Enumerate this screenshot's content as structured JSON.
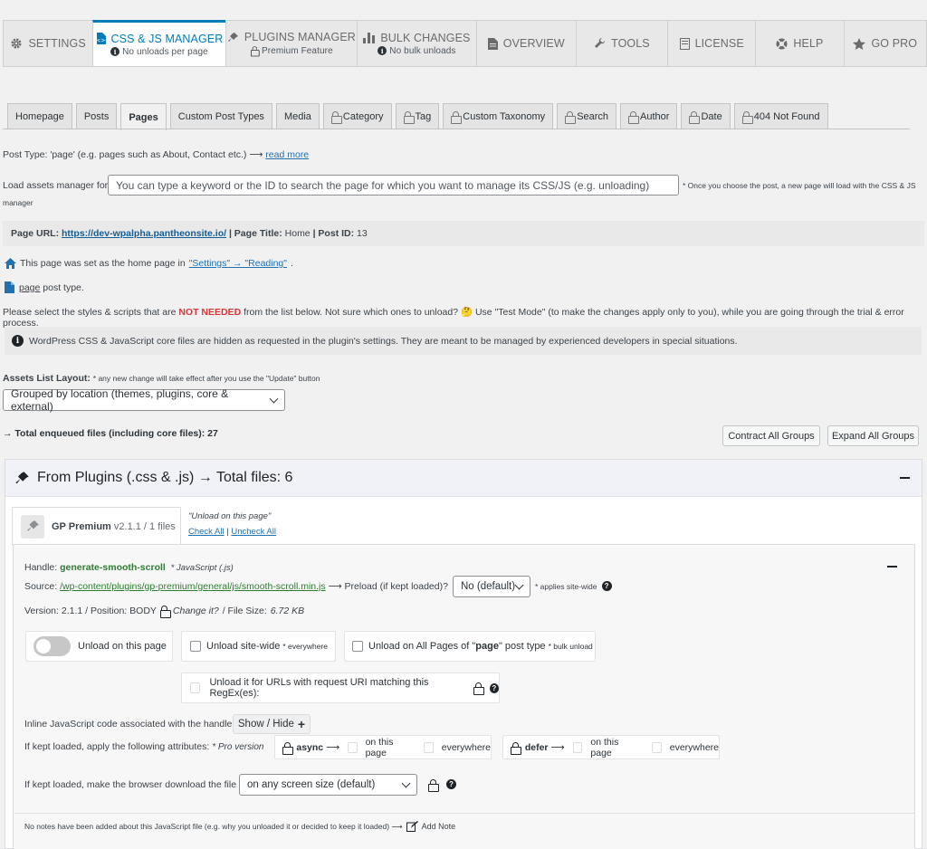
{
  "colors": {
    "accent": "#007cba",
    "red": "#d63638",
    "green": "#2e7d32",
    "link": "#2271b1"
  },
  "topnav": [
    {
      "label": "SETTINGS",
      "icon": "gear-icon",
      "sub": ""
    },
    {
      "label": "CSS & JS MANAGER",
      "icon": "css-js-icon",
      "sub": "No unloads per page",
      "active": true
    },
    {
      "label": "PLUGINS MANAGER",
      "icon": "plug-icon",
      "sub": "Premium Feature"
    },
    {
      "label": "BULK CHANGES",
      "icon": "bars-icon",
      "sub": "No bulk unloads"
    },
    {
      "label": "OVERVIEW",
      "icon": "document-icon",
      "sub": ""
    },
    {
      "label": "TOOLS",
      "icon": "wrench-icon",
      "sub": ""
    },
    {
      "label": "LICENSE",
      "icon": "license-icon",
      "sub": ""
    },
    {
      "label": "HELP",
      "icon": "lifebuoy-icon",
      "sub": ""
    },
    {
      "label": "GO PRO",
      "icon": "star-icon",
      "sub": ""
    }
  ],
  "subtabs": [
    {
      "label": "Homepage",
      "locked": false
    },
    {
      "label": "Posts",
      "locked": false
    },
    {
      "label": "Pages",
      "locked": false,
      "active": true
    },
    {
      "label": "Custom Post Types",
      "locked": false
    },
    {
      "label": "Media",
      "locked": false
    },
    {
      "label": "Category",
      "locked": true
    },
    {
      "label": "Tag",
      "locked": true
    },
    {
      "label": "Custom Taxonomy",
      "locked": true
    },
    {
      "label": "Search",
      "locked": true
    },
    {
      "label": "Author",
      "locked": true
    },
    {
      "label": "Date",
      "locked": true
    },
    {
      "label": "404 Not Found",
      "locked": true
    }
  ],
  "post_type_line": {
    "text": "Post Type: 'page' (e.g. pages such as About, Contact etc.) ⟶ ",
    "link": "read more"
  },
  "load_for": {
    "label": "Load assets manager for:",
    "placeholder": "You can type a keyword or the ID to search the page for which you want to manage its CSS/JS (e.g. unloading)",
    "note_1": "* Once you choose the post, a new page will load with the CSS & JS",
    "note_2": "manager"
  },
  "page_info": {
    "url_label": "Page URL:",
    "url": "https://dev-wpalpha.pantheonsite.io/",
    "title_label": "| Page Title:",
    "title": "Home",
    "id_label": "| Post ID:",
    "id": "13"
  },
  "home_notice": {
    "text": "This page was set as the home page in ",
    "link": "\"Settings\" → \"Reading\"",
    "end": "."
  },
  "post_type_notice": {
    "link": "page",
    "text": " post type."
  },
  "select_notice": {
    "before": "Please select the styles & scripts that are ",
    "highlight": "NOT NEEDED",
    "after": " from the list below. Not sure which ones to unload? 🤔 Use \"Test Mode\" (to make the changes apply only to you), while you are going through the trial & error process."
  },
  "core_notice": "WordPress CSS & JavaScript core files are hidden as requested in the plugin's settings. They are meant to be managed by experienced developers in special situations.",
  "layout": {
    "label": "Assets List Layout:",
    "note": "* any new change will take effect after you use the \"Update\" button",
    "value": "Grouped by location (themes, plugins, core & external)"
  },
  "total_enqueued": "→ Total enqueued files (including core files): 27",
  "buttons": {
    "contract": "Contract All Groups",
    "expand": "Expand All Groups"
  },
  "group": {
    "title": "From Plugins (.css & .js) → Total files: 6",
    "plugin_name": "GP Premium",
    "plugin_version": "v2.1.1 / 1 files",
    "unload_on_page": "\"Unload on this page\"",
    "check_all": "Check All",
    "uncheck_all": "Uncheck All"
  },
  "asset": {
    "handle_label": "Handle:",
    "handle": "generate-smooth-scroll",
    "handle_type": "* JavaScript (.js)",
    "source_label": "Source:",
    "source": "/wp-content/plugins/gp-premium/general/js/smooth-scroll.min.js",
    "preload_label": "⟶  Preload (if kept loaded)?",
    "preload_value": "No (default)",
    "preload_note": "* applies site-wide",
    "version_line_1": "Version: 2.1.1  /  Position: BODY",
    "change_it": "Change it?",
    "file_size_label": "/  File Size:",
    "file_size": "6.72 KB",
    "unload_page": "Unload on this page",
    "unload_site": "Unload site-wide",
    "unload_site_note": "* everywhere",
    "unload_all_before": "Unload on All Pages of \"",
    "unload_all_type": "page",
    "unload_all_after": "\" post type",
    "unload_all_note": "* bulk unload",
    "regex": "Unload it for URLs with request URI matching this RegEx(es):",
    "inline_label": "Inline JavaScript code associated with the handle:",
    "show_hide": "Show / Hide",
    "attrs_label": "If kept loaded, apply the following attributes:",
    "attrs_note": "* Pro version",
    "async": "async",
    "defer": "defer",
    "arrow": "⟶",
    "on_this_page": "on this page",
    "everywhere": "everywhere",
    "download_label": "If kept loaded, make the browser download the file",
    "download_value": "on any screen size (default)",
    "notes": "No notes have been added about this JavaScript file (e.g. why you unloaded it or decided to keep it loaded) ⟶",
    "add_note": "Add Note"
  }
}
